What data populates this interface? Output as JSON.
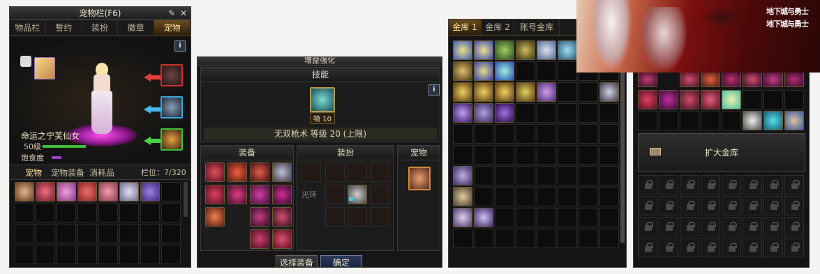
{
  "pet_window": {
    "title": "宠物栏(F6)",
    "tabs": [
      "物品栏",
      "誓约",
      "装扮",
      "徽章",
      "宠物"
    ],
    "active_tab": 4,
    "pet_name": "命运之宁芙仙女",
    "pet_level": "50级",
    "hunger_label": "饱食度",
    "sub_tabs": [
      "宠物",
      "宠物装备",
      "消耗品"
    ],
    "slot_count": "栏位：7/320",
    "info": "i",
    "colors": {
      "red": "#c8322a",
      "blue": "#3aa6d8",
      "green": "#3ec03a"
    }
  },
  "enhance_window": {
    "title": "增益强化",
    "skill_header": "技能",
    "skill_badge": "犄 10",
    "skill_line": "无双枪术 等级 20 (上限)",
    "info": "i",
    "sections": [
      "装备",
      "装扮",
      "宠物"
    ],
    "aura_label": "光环",
    "select_button": "选择装备",
    "confirm_button": "确定"
  },
  "vault_window": {
    "tabs": [
      "金库 1",
      "金库 2",
      "账号金库"
    ]
  },
  "account_vault": {
    "expand_button": "扩大金库"
  },
  "banner": {
    "logo_line1": "地下城与勇士",
    "logo_line2": "地下城与勇士"
  }
}
